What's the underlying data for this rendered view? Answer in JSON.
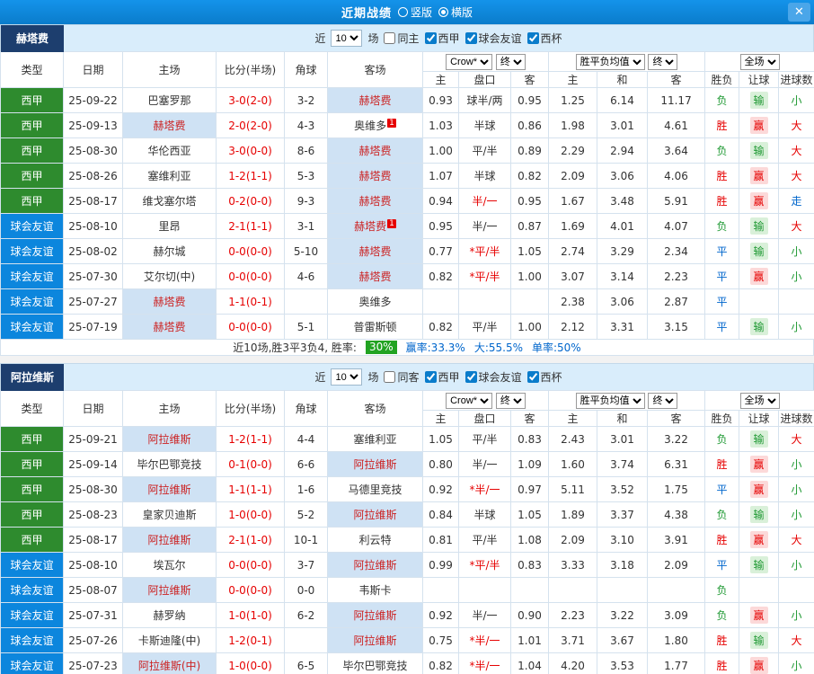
{
  "topbar": {
    "title": "近期战绩",
    "radios": [
      {
        "label": "竖版",
        "selected": false
      },
      {
        "label": "横版",
        "selected": true
      }
    ],
    "close": "✕"
  },
  "table_header": {
    "cols": [
      "类型",
      "日期",
      "主场",
      "比分(半场)",
      "角球",
      "客场"
    ],
    "sub_cols": [
      "主",
      "盘口",
      "客",
      "主",
      "和",
      "客",
      "胜负",
      "让球",
      "进球数"
    ],
    "dropdowns": {
      "bookmaker": "Crow*",
      "period": "终",
      "avg": "胜平负均值",
      "scope": "全场"
    }
  },
  "colors": {
    "topbar_blue": "#0d86d9",
    "league_green": "#2e8b2e",
    "friendly_blue": "#0c86dd",
    "team_banner_navy": "#1d3e6e",
    "highlight_bg": "#cfe2f4",
    "score_red": "#e60000",
    "win_red": "#e60000",
    "draw_blue": "#0066cc",
    "loss_green": "#1f9933",
    "rate_badge_green": "#22a322"
  },
  "sections": [
    {
      "team": "赫塔费",
      "filters": {
        "recent_label": "近",
        "count": "10",
        "games_label": "场",
        "same_venue": {
          "label": "同主",
          "checked": false
        },
        "leagues": [
          {
            "label": "西甲",
            "checked": true
          },
          {
            "label": "球会友谊",
            "checked": true
          },
          {
            "label": "西杯",
            "checked": true
          }
        ]
      },
      "rows": [
        {
          "comp": "league",
          "type": "西甲",
          "date": "25-09-22",
          "home": "巴塞罗那",
          "home_hl": false,
          "home_rc": false,
          "score": "3-0(2-0)",
          "corner": "3-2",
          "away": "赫塔费",
          "away_hl": true,
          "away_rc": false,
          "ah_home": "0.93",
          "ah_line": "球半/两",
          "ah_hot": false,
          "ah_away": "0.95",
          "avg_home": "1.25",
          "avg_draw": "6.14",
          "avg_away": "11.17",
          "result": "负",
          "handicap": "输",
          "goals": "小"
        },
        {
          "comp": "league",
          "type": "西甲",
          "date": "25-09-13",
          "home": "赫塔费",
          "home_hl": true,
          "home_rc": false,
          "score": "2-0(2-0)",
          "corner": "4-3",
          "away": "奥维多",
          "away_hl": false,
          "away_rc": true,
          "ah_home": "1.03",
          "ah_line": "半球",
          "ah_hot": false,
          "ah_away": "0.86",
          "avg_home": "1.98",
          "avg_draw": "3.01",
          "avg_away": "4.61",
          "result": "胜",
          "handicap": "赢",
          "goals": "大"
        },
        {
          "comp": "league",
          "type": "西甲",
          "date": "25-08-30",
          "home": "华伦西亚",
          "home_hl": false,
          "home_rc": false,
          "score": "3-0(0-0)",
          "corner": "8-6",
          "away": "赫塔费",
          "away_hl": true,
          "away_rc": false,
          "ah_home": "1.00",
          "ah_line": "平/半",
          "ah_hot": false,
          "ah_away": "0.89",
          "avg_home": "2.29",
          "avg_draw": "2.94",
          "avg_away": "3.64",
          "result": "负",
          "handicap": "输",
          "goals": "大"
        },
        {
          "comp": "league",
          "type": "西甲",
          "date": "25-08-26",
          "home": "塞维利亚",
          "home_hl": false,
          "home_rc": false,
          "score": "1-2(1-1)",
          "corner": "5-3",
          "away": "赫塔费",
          "away_hl": true,
          "away_rc": false,
          "ah_home": "1.07",
          "ah_line": "半球",
          "ah_hot": false,
          "ah_away": "0.82",
          "avg_home": "2.09",
          "avg_draw": "3.06",
          "avg_away": "4.06",
          "result": "胜",
          "handicap": "赢",
          "goals": "大"
        },
        {
          "comp": "league",
          "type": "西甲",
          "date": "25-08-17",
          "home": "维戈塞尔塔",
          "home_hl": false,
          "home_rc": false,
          "score": "0-2(0-0)",
          "corner": "9-3",
          "away": "赫塔费",
          "away_hl": true,
          "away_rc": false,
          "ah_home": "0.94",
          "ah_line": "半/一",
          "ah_hot": true,
          "ah_away": "0.95",
          "avg_home": "1.67",
          "avg_draw": "3.48",
          "avg_away": "5.91",
          "result": "胜",
          "handicap": "赢",
          "goals": "走"
        },
        {
          "comp": "friendly",
          "type": "球会友谊",
          "date": "25-08-10",
          "home": "里昂",
          "home_hl": false,
          "home_rc": false,
          "score": "2-1(1-1)",
          "corner": "3-1",
          "away": "赫塔费",
          "away_hl": true,
          "away_rc": true,
          "ah_home": "0.95",
          "ah_line": "半/一",
          "ah_hot": false,
          "ah_away": "0.87",
          "avg_home": "1.69",
          "avg_draw": "4.01",
          "avg_away": "4.07",
          "result": "负",
          "handicap": "输",
          "goals": "大"
        },
        {
          "comp": "friendly",
          "type": "球会友谊",
          "date": "25-08-02",
          "home": "赫尔城",
          "home_hl": false,
          "home_rc": false,
          "score": "0-0(0-0)",
          "corner": "5-10",
          "away": "赫塔费",
          "away_hl": true,
          "away_rc": false,
          "ah_home": "0.77",
          "ah_line": "*平/半",
          "ah_hot": true,
          "ah_away": "1.05",
          "avg_home": "2.74",
          "avg_draw": "3.29",
          "avg_away": "2.34",
          "result": "平",
          "handicap": "输",
          "goals": "小"
        },
        {
          "comp": "friendly",
          "type": "球会友谊",
          "date": "25-07-30",
          "home": "艾尔切(中)",
          "home_hl": false,
          "home_rc": false,
          "score": "0-0(0-0)",
          "corner": "4-6",
          "away": "赫塔费",
          "away_hl": true,
          "away_rc": false,
          "ah_home": "0.82",
          "ah_line": "*平/半",
          "ah_hot": true,
          "ah_away": "1.00",
          "avg_home": "3.07",
          "avg_draw": "3.14",
          "avg_away": "2.23",
          "result": "平",
          "handicap": "赢",
          "goals": "小"
        },
        {
          "comp": "friendly",
          "type": "球会友谊",
          "date": "25-07-27",
          "home": "赫塔费",
          "home_hl": true,
          "home_rc": false,
          "score": "1-1(0-1)",
          "corner": "",
          "away": "奥维多",
          "away_hl": false,
          "away_rc": false,
          "ah_home": "",
          "ah_line": "",
          "ah_hot": false,
          "ah_away": "",
          "avg_home": "2.38",
          "avg_draw": "3.06",
          "avg_away": "2.87",
          "result": "平",
          "handicap": "",
          "goals": ""
        },
        {
          "comp": "friendly",
          "type": "球会友谊",
          "date": "25-07-19",
          "home": "赫塔费",
          "home_hl": true,
          "home_rc": false,
          "score": "0-0(0-0)",
          "corner": "5-1",
          "away": "普雷斯顿",
          "away_hl": false,
          "away_rc": false,
          "ah_home": "0.82",
          "ah_line": "平/半",
          "ah_hot": false,
          "ah_away": "1.00",
          "avg_home": "2.12",
          "avg_draw": "3.31",
          "avg_away": "3.15",
          "result": "平",
          "handicap": "输",
          "goals": "小"
        }
      ],
      "summary": {
        "text_before": "近10场,胜3平3负4, 胜率:",
        "rate": "30%",
        "stats": [
          "赢率:33.3%",
          "大:55.5%",
          "单率:50%"
        ]
      }
    },
    {
      "team": "阿拉维斯",
      "filters": {
        "recent_label": "近",
        "count": "10",
        "games_label": "场",
        "same_venue": {
          "label": "同客",
          "checked": false
        },
        "leagues": [
          {
            "label": "西甲",
            "checked": true
          },
          {
            "label": "球会友谊",
            "checked": true
          },
          {
            "label": "西杯",
            "checked": true
          }
        ]
      },
      "rows": [
        {
          "comp": "league",
          "type": "西甲",
          "date": "25-09-21",
          "home": "阿拉维斯",
          "home_hl": true,
          "home_rc": false,
          "score": "1-2(1-1)",
          "corner": "4-4",
          "away": "塞维利亚",
          "away_hl": false,
          "away_rc": false,
          "ah_home": "1.05",
          "ah_line": "平/半",
          "ah_hot": false,
          "ah_away": "0.83",
          "avg_home": "2.43",
          "avg_draw": "3.01",
          "avg_away": "3.22",
          "result": "负",
          "handicap": "输",
          "goals": "大"
        },
        {
          "comp": "league",
          "type": "西甲",
          "date": "25-09-14",
          "home": "毕尔巴鄂竞技",
          "home_hl": false,
          "home_rc": false,
          "score": "0-1(0-0)",
          "corner": "6-6",
          "away": "阿拉维斯",
          "away_hl": true,
          "away_rc": false,
          "ah_home": "0.80",
          "ah_line": "半/一",
          "ah_hot": false,
          "ah_away": "1.09",
          "avg_home": "1.60",
          "avg_draw": "3.74",
          "avg_away": "6.31",
          "result": "胜",
          "handicap": "赢",
          "goals": "小"
        },
        {
          "comp": "league",
          "type": "西甲",
          "date": "25-08-30",
          "home": "阿拉维斯",
          "home_hl": true,
          "home_rc": false,
          "score": "1-1(1-1)",
          "corner": "1-6",
          "away": "马德里竞技",
          "away_hl": false,
          "away_rc": false,
          "ah_home": "0.92",
          "ah_line": "*半/一",
          "ah_hot": true,
          "ah_away": "0.97",
          "avg_home": "5.11",
          "avg_draw": "3.52",
          "avg_away": "1.75",
          "result": "平",
          "handicap": "赢",
          "goals": "小"
        },
        {
          "comp": "league",
          "type": "西甲",
          "date": "25-08-23",
          "home": "皇家贝迪斯",
          "home_hl": false,
          "home_rc": false,
          "score": "1-0(0-0)",
          "corner": "5-2",
          "away": "阿拉维斯",
          "away_hl": true,
          "away_rc": false,
          "ah_home": "0.84",
          "ah_line": "半球",
          "ah_hot": false,
          "ah_away": "1.05",
          "avg_home": "1.89",
          "avg_draw": "3.37",
          "avg_away": "4.38",
          "result": "负",
          "handicap": "输",
          "goals": "小"
        },
        {
          "comp": "league",
          "type": "西甲",
          "date": "25-08-17",
          "home": "阿拉维斯",
          "home_hl": true,
          "home_rc": false,
          "score": "2-1(1-0)",
          "corner": "10-1",
          "away": "利云特",
          "away_hl": false,
          "away_rc": false,
          "ah_home": "0.81",
          "ah_line": "平/半",
          "ah_hot": false,
          "ah_away": "1.08",
          "avg_home": "2.09",
          "avg_draw": "3.10",
          "avg_away": "3.91",
          "result": "胜",
          "handicap": "赢",
          "goals": "大"
        },
        {
          "comp": "friendly",
          "type": "球会友谊",
          "date": "25-08-10",
          "home": "埃瓦尔",
          "home_hl": false,
          "home_rc": false,
          "score": "0-0(0-0)",
          "corner": "3-7",
          "away": "阿拉维斯",
          "away_hl": true,
          "away_rc": false,
          "ah_home": "0.99",
          "ah_line": "*平/半",
          "ah_hot": true,
          "ah_away": "0.83",
          "avg_home": "3.33",
          "avg_draw": "3.18",
          "avg_away": "2.09",
          "result": "平",
          "handicap": "输",
          "goals": "小"
        },
        {
          "comp": "friendly",
          "type": "球会友谊",
          "date": "25-08-07",
          "home": "阿拉维斯",
          "home_hl": true,
          "home_rc": false,
          "score": "0-0(0-0)",
          "corner": "0-0",
          "away": "韦斯卡",
          "away_hl": false,
          "away_rc": false,
          "ah_home": "",
          "ah_line": "",
          "ah_hot": false,
          "ah_away": "",
          "avg_home": "",
          "avg_draw": "",
          "avg_away": "",
          "result": "负",
          "handicap": "",
          "goals": ""
        },
        {
          "comp": "friendly",
          "type": "球会友谊",
          "date": "25-07-31",
          "home": "赫罗纳",
          "home_hl": false,
          "home_rc": false,
          "score": "1-0(1-0)",
          "corner": "6-2",
          "away": "阿拉维斯",
          "away_hl": true,
          "away_rc": false,
          "ah_home": "0.92",
          "ah_line": "半/一",
          "ah_hot": false,
          "ah_away": "0.90",
          "avg_home": "2.23",
          "avg_draw": "3.22",
          "avg_away": "3.09",
          "result": "负",
          "handicap": "赢",
          "goals": "小"
        },
        {
          "comp": "friendly",
          "type": "球会友谊",
          "date": "25-07-26",
          "home": "卡斯迪隆(中)",
          "home_hl": false,
          "home_rc": false,
          "score": "1-2(0-1)",
          "corner": "",
          "away": "阿拉维斯",
          "away_hl": true,
          "away_rc": false,
          "ah_home": "0.75",
          "ah_line": "*半/一",
          "ah_hot": true,
          "ah_away": "1.01",
          "avg_home": "3.71",
          "avg_draw": "3.67",
          "avg_away": "1.80",
          "result": "胜",
          "handicap": "输",
          "goals": "大"
        },
        {
          "comp": "friendly",
          "type": "球会友谊",
          "date": "25-07-23",
          "home": "阿拉维斯(中)",
          "home_hl": true,
          "home_rc": false,
          "score": "1-0(0-0)",
          "corner": "6-5",
          "away": "毕尔巴鄂竞技",
          "away_hl": false,
          "away_rc": false,
          "ah_home": "0.82",
          "ah_line": "*半/一",
          "ah_hot": true,
          "ah_away": "1.04",
          "avg_home": "4.20",
          "avg_draw": "3.53",
          "avg_away": "1.77",
          "result": "胜",
          "handicap": "赢",
          "goals": "小"
        }
      ]
    }
  ]
}
